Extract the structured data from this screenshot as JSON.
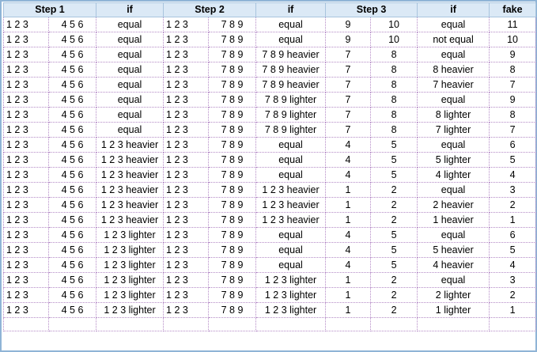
{
  "headers": [
    "Step 1",
    "if",
    "Step 2",
    "if",
    "Step 3",
    "if",
    "fake"
  ],
  "rows": [
    [
      "1 2 3",
      "4 5 6",
      "equal",
      "1 2 3",
      "7 8 9",
      "equal",
      "9",
      "10",
      "equal",
      "11"
    ],
    [
      "1 2 3",
      "4 5 6",
      "equal",
      "1 2 3",
      "7 8 9",
      "equal",
      "9",
      "10",
      "not equal",
      "10"
    ],
    [
      "1 2 3",
      "4 5 6",
      "equal",
      "1 2 3",
      "7 8 9",
      "7 8 9 heavier",
      "7",
      "8",
      "equal",
      "9"
    ],
    [
      "1 2 3",
      "4 5 6",
      "equal",
      "1 2 3",
      "7 8 9",
      "7 8 9 heavier",
      "7",
      "8",
      "8 heavier",
      "8"
    ],
    [
      "1 2 3",
      "4 5 6",
      "equal",
      "1 2 3",
      "7 8 9",
      "7 8 9 heavier",
      "7",
      "8",
      "7 heavier",
      "7"
    ],
    [
      "1 2 3",
      "4 5 6",
      "equal",
      "1 2 3",
      "7 8 9",
      "7 8 9 lighter",
      "7",
      "8",
      "equal",
      "9"
    ],
    [
      "1 2 3",
      "4 5 6",
      "equal",
      "1 2 3",
      "7 8 9",
      "7 8 9 lighter",
      "7",
      "8",
      "8 lighter",
      "8"
    ],
    [
      "1 2 3",
      "4 5 6",
      "equal",
      "1 2 3",
      "7 8 9",
      "7 8 9 lighter",
      "7",
      "8",
      "7 lighter",
      "7"
    ],
    [
      "1 2 3",
      "4 5 6",
      "1 2 3 heavier",
      "1 2 3",
      "7 8 9",
      "equal",
      "4",
      "5",
      "equal",
      "6"
    ],
    [
      "1 2 3",
      "4 5 6",
      "1 2 3 heavier",
      "1 2 3",
      "7 8 9",
      "equal",
      "4",
      "5",
      "5 lighter",
      "5"
    ],
    [
      "1 2 3",
      "4 5 6",
      "1 2 3 heavier",
      "1 2 3",
      "7 8 9",
      "equal",
      "4",
      "5",
      "4 lighter",
      "4"
    ],
    [
      "1 2 3",
      "4 5 6",
      "1 2 3 heavier",
      "1 2 3",
      "7 8 9",
      "1 2 3 heavier",
      "1",
      "2",
      "equal",
      "3"
    ],
    [
      "1 2 3",
      "4 5 6",
      "1 2 3 heavier",
      "1 2 3",
      "7 8 9",
      "1 2 3 heavier",
      "1",
      "2",
      "2 heavier",
      "2"
    ],
    [
      "1 2 3",
      "4 5 6",
      "1 2 3 heavier",
      "1 2 3",
      "7 8 9",
      "1 2 3 heavier",
      "1",
      "2",
      "1 heavier",
      "1"
    ],
    [
      "1 2 3",
      "4 5 6",
      "1 2 3 lighter",
      "1 2 3",
      "7 8 9",
      "equal",
      "4",
      "5",
      "equal",
      "6"
    ],
    [
      "1 2 3",
      "4 5 6",
      "1 2 3 lighter",
      "1 2 3",
      "7 8 9",
      "equal",
      "4",
      "5",
      "5 heavier",
      "5"
    ],
    [
      "1 2 3",
      "4 5 6",
      "1 2 3 lighter",
      "1 2 3",
      "7 8 9",
      "equal",
      "4",
      "5",
      "4 heavier",
      "4"
    ],
    [
      "1 2 3",
      "4 5 6",
      "1 2 3 lighter",
      "1 2 3",
      "7 8 9",
      "1 2 3 lighter",
      "1",
      "2",
      "equal",
      "3"
    ],
    [
      "1 2 3",
      "4 5 6",
      "1 2 3 lighter",
      "1 2 3",
      "7 8 9",
      "1 2 3 lighter",
      "1",
      "2",
      "2 lighter",
      "2"
    ],
    [
      "1 2 3",
      "4 5 6",
      "1 2 3 lighter",
      "1 2 3",
      "7 8 9",
      "1 2 3 lighter",
      "1",
      "2",
      "1 lighter",
      "1"
    ]
  ],
  "colors": {
    "header_bg": "#dbe9f6",
    "grid": "#b48ac6",
    "frame": "#8fb4d6"
  }
}
